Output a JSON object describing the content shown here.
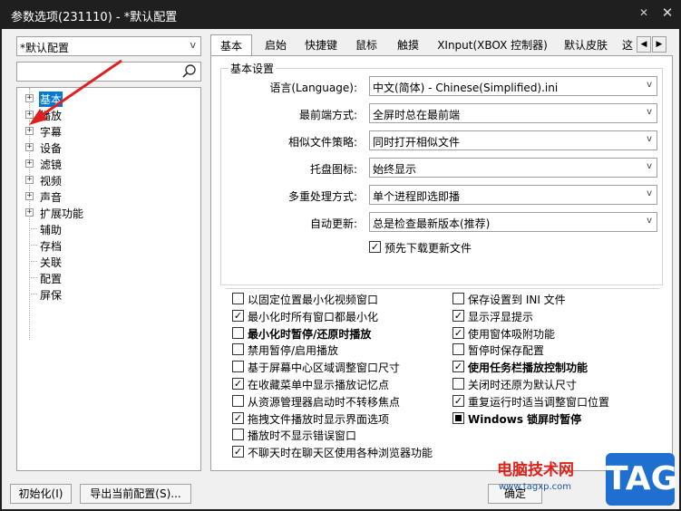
{
  "window": {
    "title": "参数选项(231110) - *默认配置",
    "pin_icon": "pin-icon",
    "close_icon": "close-icon"
  },
  "left": {
    "preset_value": "*默认配置",
    "search_value": "",
    "tree": [
      {
        "label": "基本",
        "expandable": true,
        "selected": true
      },
      {
        "label": "播放",
        "expandable": true
      },
      {
        "label": "字幕",
        "expandable": true
      },
      {
        "label": "设备",
        "expandable": true
      },
      {
        "label": "滤镜",
        "expandable": true
      },
      {
        "label": "视频",
        "expandable": true
      },
      {
        "label": "声音",
        "expandable": true
      },
      {
        "label": "扩展功能",
        "expandable": true
      },
      {
        "label": "辅助",
        "expandable": false
      },
      {
        "label": "存档",
        "expandable": false
      },
      {
        "label": "关联",
        "expandable": false
      },
      {
        "label": "配置",
        "expandable": false
      },
      {
        "label": "屏保",
        "expandable": false
      }
    ]
  },
  "tabs": [
    "基本",
    "启始",
    "快捷键",
    "鼠标",
    "触摸",
    "XInput(XBOX 控制器)",
    "默认皮肤",
    "这"
  ],
  "basic": {
    "group_title": "基本设置",
    "fields": [
      {
        "label": "语言(Language):",
        "value": "中文(简体) - Chinese(Simplified).ini"
      },
      {
        "label": "最前端方式:",
        "value": "全屏时总在最前端"
      },
      {
        "label": "相似文件策略:",
        "value": "同时打开相似文件"
      },
      {
        "label": "托盘图标:",
        "value": "始终显示"
      },
      {
        "label": "多重处理方式:",
        "value": "单个进程即选即播"
      },
      {
        "label": "自动更新:",
        "value": "总是检查最新版本(推荐)"
      }
    ],
    "predownload": {
      "label": "预先下载更新文件",
      "checked": true
    }
  },
  "options_left": [
    {
      "label": "以固定位置最小化视频窗口",
      "state": "unchecked"
    },
    {
      "label": "最小化时所有窗口都最小化",
      "state": "checked"
    },
    {
      "label": "最小化时暂停/还原时播放",
      "state": "unchecked",
      "bold": true
    },
    {
      "label": "禁用暂停/启用播放",
      "state": "unchecked"
    },
    {
      "label": "基于屏幕中心区域调整窗口尺寸",
      "state": "unchecked"
    },
    {
      "label": "在收藏菜单中显示播放记忆点",
      "state": "checked"
    },
    {
      "label": "从资源管理器启动时不转移焦点",
      "state": "unchecked"
    },
    {
      "label": "拖拽文件播放时显示界面选项",
      "state": "checked"
    },
    {
      "label": "播放时不显示错误窗口",
      "state": "unchecked"
    },
    {
      "label": "不聊天时在聊天区使用各种浏览器功能",
      "state": "checked"
    }
  ],
  "options_right": [
    {
      "label": "保存设置到 INI 文件",
      "state": "unchecked"
    },
    {
      "label": "显示浮显提示",
      "state": "checked"
    },
    {
      "label": "使用窗体吸附功能",
      "state": "checked"
    },
    {
      "label": "暂停时保存配置",
      "state": "unchecked"
    },
    {
      "label": "使用任务栏播放控制功能",
      "state": "checked",
      "bold": true
    },
    {
      "label": "关闭时还原为默认尺寸",
      "state": "unchecked"
    },
    {
      "label": "重复运行时适当调整窗口位置",
      "state": "checked"
    },
    {
      "label": "Windows 锁屏时暂停",
      "state": "indeterminate",
      "bold": true
    }
  ],
  "buttons": {
    "init": "初始化(I)",
    "export": "导出当前配置(S)...",
    "ok_partial": "确定"
  },
  "watermark": {
    "site": "电脑技术网",
    "url": "www.tagxp.com",
    "tag": "TAG"
  },
  "colors": {
    "selection": "#0078d7",
    "annotation_arrow": "#e02020",
    "titlebar": "#1f1f1f"
  }
}
